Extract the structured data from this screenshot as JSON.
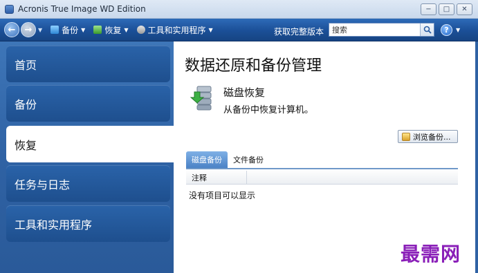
{
  "window": {
    "title": "Acronis True Image WD Edition",
    "controls": {
      "minimize": "−",
      "maximize": "□",
      "close": "✕"
    }
  },
  "toolbar": {
    "back_icon": "arrow-left-icon",
    "forward_icon": "arrow-right-icon",
    "items": [
      {
        "label": "备份",
        "icon": "backup-icon"
      },
      {
        "label": "恢复",
        "icon": "restore-icon"
      },
      {
        "label": "工具和实用程序",
        "icon": "tools-icon"
      }
    ],
    "get_full_version": "获取完整版本",
    "search": {
      "value": "搜索",
      "placeholder": "搜索"
    },
    "help_label": "?"
  },
  "sidebar": {
    "items": [
      {
        "label": "首页",
        "active": false
      },
      {
        "label": "备份",
        "active": false
      },
      {
        "label": "恢复",
        "active": true
      },
      {
        "label": "任务与日志",
        "active": false
      },
      {
        "label": "工具和实用程序",
        "active": false
      }
    ]
  },
  "main": {
    "page_title": "数据还原和备份管理",
    "feature": {
      "title": "磁盘恢复",
      "description": "从备份中恢复计算机。",
      "icon": "disk-restore-icon"
    },
    "browse_button": "浏览备份...",
    "tabs": [
      {
        "label": "磁盘备份",
        "active": true
      },
      {
        "label": "文件备份",
        "active": false
      }
    ],
    "table": {
      "columns": [
        "注释",
        ""
      ],
      "empty_message": "没有项目可以显示"
    }
  },
  "watermark": "最需网",
  "colors": {
    "toolbar": "#1b4f97",
    "sidebar": "#2f62a4",
    "accent_tab": "#4a82c6",
    "watermark": "#8a1fb8"
  }
}
